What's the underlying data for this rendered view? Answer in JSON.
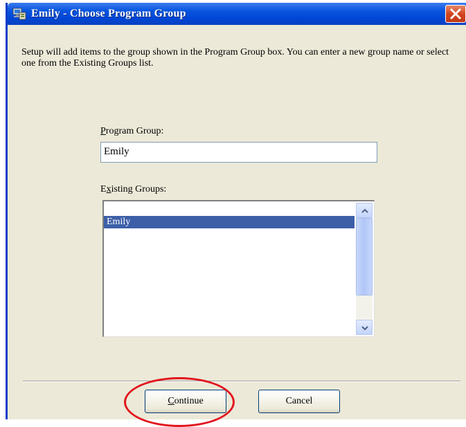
{
  "window": {
    "title": "Emily - Choose Program Group",
    "app_icon": "computer-setup-icon",
    "close_icon": "close-icon"
  },
  "dialog": {
    "intro_text": "Setup will add items to the group shown in the Program Group box.  You can enter a new group name or select one from the Existing Groups list.",
    "program_group": {
      "label_first": "P",
      "label_rest": "rogram Group:",
      "value": "Emily"
    },
    "existing_groups": {
      "label_first": "E",
      "label_mid": "x",
      "label_rest": "isting Groups:",
      "items": [
        "Emily"
      ],
      "selected": "Emily"
    }
  },
  "buttons": {
    "continue_first": "C",
    "continue_rest": "ontinue",
    "cancel": "Cancel"
  },
  "colors": {
    "titlebar": "#0a56e0",
    "selection": "#3d5fa8",
    "highlight_ellipse": "#e2141e",
    "dialog_bg": "#ece9d8"
  }
}
